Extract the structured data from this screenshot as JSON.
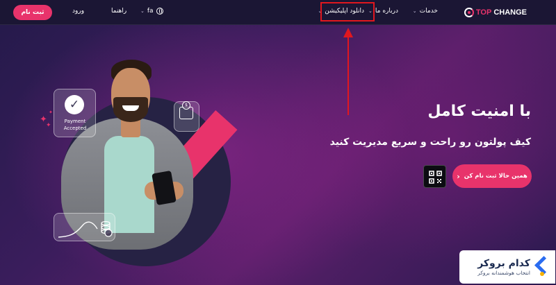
{
  "header": {
    "logo_top": "TOP",
    "logo_change": "CHANGE",
    "nav": {
      "services": "خدمات",
      "about": "درباره ما",
      "download_app": "دانلود اپلیکیشن",
      "language": "fa",
      "guide": "راهنما",
      "login": "ورود",
      "register": "ثبت نام"
    }
  },
  "hero": {
    "title": "با امنیت کامل",
    "subtitle": "کیف پولتون رو راحت و سریع مدیریت کنید",
    "cta": "همین حالا ثبت نام کن"
  },
  "illustration": {
    "payment_badge_line1": "Payment",
    "payment_badge_line2": "Accepted",
    "check_glyph": "✓"
  },
  "watermark": {
    "title": "کدام بروکر",
    "subtitle": "انتخاب هوشمندانه بروکر"
  },
  "colors": {
    "accent": "#e8336b",
    "annotation_red": "#e1171e",
    "header_bg": "#1b1634"
  },
  "icons": [
    "logo-icon",
    "globe-icon",
    "chevron-down-icon",
    "qr-code-icon",
    "arrow-left-icon",
    "wallet-icon",
    "check-icon",
    "sparkle-icon",
    "coins-icon"
  ]
}
